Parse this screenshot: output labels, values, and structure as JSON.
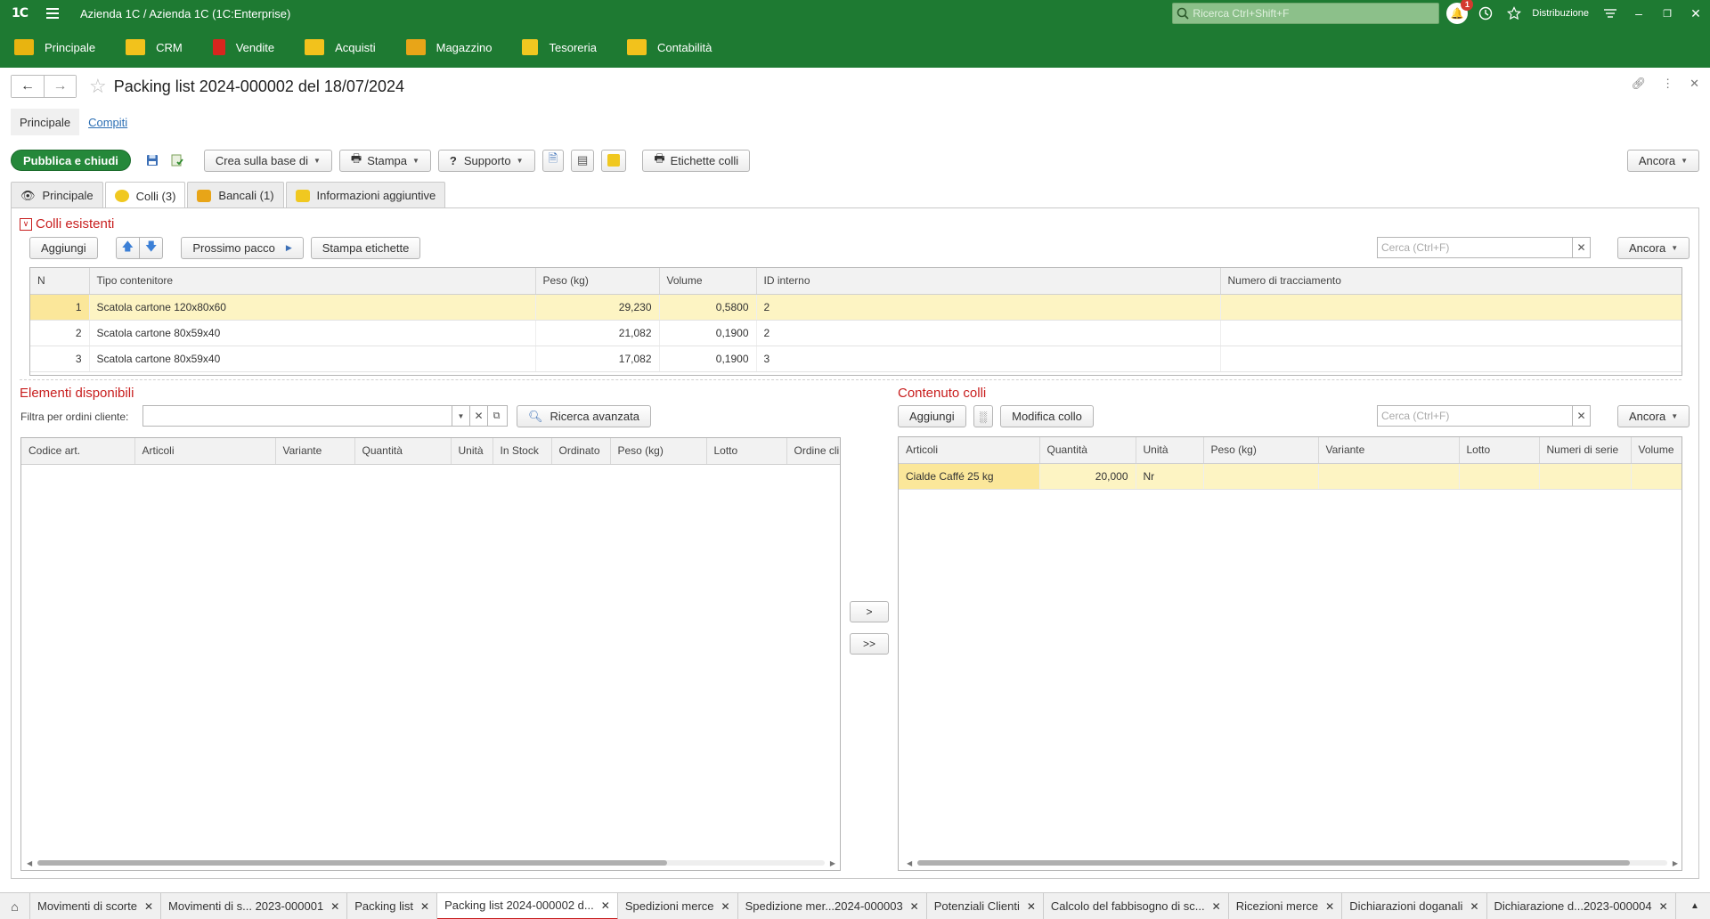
{
  "topbar": {
    "logo": "1С",
    "app_title": "Azienda 1C / Azienda 1C  (1C:Enterprise)",
    "search_placeholder": "Ricerca Ctrl+Shift+F",
    "notifications_count": "1",
    "user_label": "Distribuzione"
  },
  "sections": [
    {
      "label": "Principale",
      "color": "#e8b410"
    },
    {
      "label": "CRM",
      "color": "#f2c21c"
    },
    {
      "label": "Vendite",
      "color": "#d8261e"
    },
    {
      "label": "Acquisti",
      "color": "#f2c21c"
    },
    {
      "label": "Magazzino",
      "color": "#e8a518"
    },
    {
      "label": "Tesoreria",
      "color": "#f0c820"
    },
    {
      "label": "Contabilità",
      "color": "#f2c21c"
    }
  ],
  "form": {
    "title": "Packing list 2024-000002 del 18/07/2024",
    "nav": {
      "main": "Principale",
      "tasks": "Compiti"
    }
  },
  "commands": {
    "post_close": "Pubblica e chiudi",
    "create_based": "Crea sulla base di",
    "print": "Stampa",
    "support": "Supporto",
    "labels": "Etichette colli",
    "more": "Ancora"
  },
  "tabs": [
    {
      "label": "Principale",
      "color": "#444"
    },
    {
      "label": "Colli (3)",
      "color": "#f0c820"
    },
    {
      "label": "Bancali (1)",
      "color": "#e8a518"
    },
    {
      "label": "Informazioni aggiuntive",
      "color": "#f0c820"
    }
  ],
  "packages": {
    "group_title": "Colli esistenti",
    "add": "Aggiungi",
    "next_package": "Prossimo pacco",
    "print_labels": "Stampa etichette",
    "search_placeholder": "Cerca (Ctrl+F)",
    "more": "Ancora",
    "columns": [
      "N",
      "Tipo contenitore",
      "Peso (kg)",
      "Volume",
      "ID interno",
      "Numero di tracciamento"
    ],
    "rows": [
      {
        "n": "1",
        "type": "Scatola cartone 120x80x60",
        "weight": "29,230",
        "volume": "0,5800",
        "id": "2",
        "tracking": ""
      },
      {
        "n": "2",
        "type": "Scatola cartone 80x59x40",
        "weight": "21,082",
        "volume": "0,1900",
        "id": "2",
        "tracking": ""
      },
      {
        "n": "3",
        "type": "Scatola cartone 80x59x40",
        "weight": "17,082",
        "volume": "0,1900",
        "id": "3",
        "tracking": ""
      }
    ]
  },
  "available": {
    "title": "Elementi disponibili",
    "filter_label": "Filtra per ordini cliente:",
    "filter_value": "",
    "advanced_search": "Ricerca avanzata",
    "columns": [
      "Codice art.",
      "Articoli",
      "Variante",
      "Quantità",
      "Unità",
      "In Stock",
      "Ordinato",
      "Peso (kg)",
      "Lotto",
      "Ordine cli"
    ],
    "scroll_fraction": 0.8
  },
  "move": {
    "one": ">",
    "all": ">>"
  },
  "contents": {
    "title": "Contenuto colli",
    "add": "Aggiungi",
    "edit_package": "Modifica collo",
    "search_placeholder": "Cerca (Ctrl+F)",
    "more": "Ancora",
    "columns": [
      "Articoli",
      "Quantità",
      "Unità",
      "Peso (kg)",
      "Variante",
      "Lotto",
      "Numeri di serie",
      "Volume"
    ],
    "rows": [
      {
        "item": "Cialde Caffé 25 kg",
        "qty": "20,000",
        "unit": "Nr",
        "weight": "",
        "variant": "",
        "lot": "",
        "serials": "",
        "volume": ""
      }
    ],
    "scroll_fraction": 0.95
  },
  "windows": [
    {
      "label": "Movimenti di scorte",
      "active": false
    },
    {
      "label": "Movimenti di s...  2023-000001",
      "active": false
    },
    {
      "label": "Packing list",
      "active": false
    },
    {
      "label": "Packing list 2024-000002 d...",
      "active": true
    },
    {
      "label": "Spedizioni merce",
      "active": false
    },
    {
      "label": "Spedizione mer...2024-000003",
      "active": false
    },
    {
      "label": "Potenziali Clienti",
      "active": false
    },
    {
      "label": "Calcolo del fabbisogno di sc...",
      "active": false
    },
    {
      "label": "Ricezioni merce",
      "active": false
    },
    {
      "label": "Dichiarazioni doganali",
      "active": false
    },
    {
      "label": "Dichiarazione d...2023-000004",
      "active": false
    }
  ]
}
